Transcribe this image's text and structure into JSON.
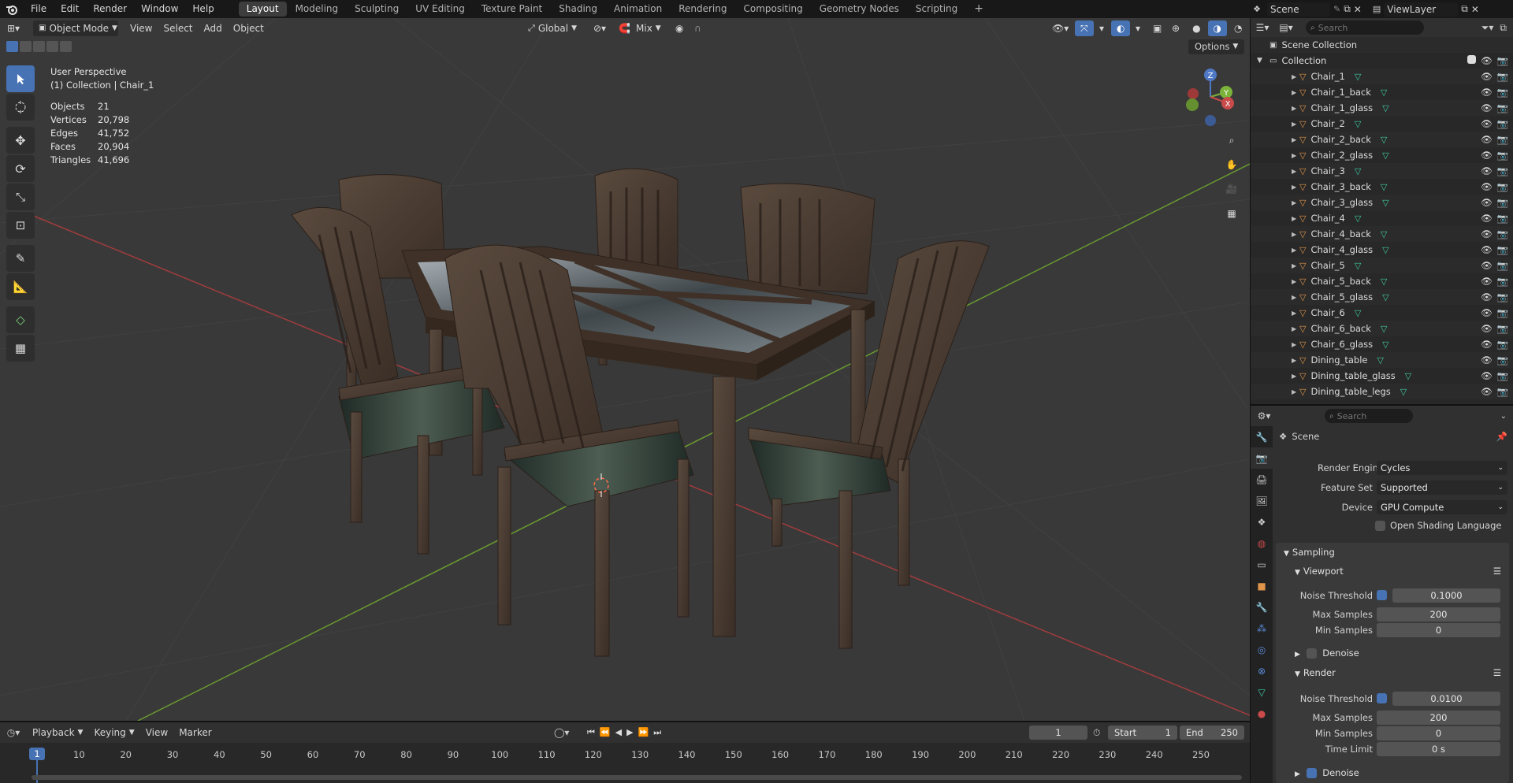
{
  "menu": {
    "items": [
      "File",
      "Edit",
      "Render",
      "Window",
      "Help"
    ]
  },
  "workspaces": {
    "tabs": [
      "Layout",
      "Modeling",
      "Sculpting",
      "UV Editing",
      "Texture Paint",
      "Shading",
      "Animation",
      "Rendering",
      "Compositing",
      "Geometry Nodes",
      "Scripting"
    ],
    "active": "Layout",
    "add": "+"
  },
  "scene": {
    "label": "Scene"
  },
  "viewlayer": {
    "label": "ViewLayer"
  },
  "viewport": {
    "mode": "Object Mode",
    "menus": [
      "View",
      "Select",
      "Add",
      "Object"
    ],
    "orientation": "Global",
    "snap_mode": "Mix",
    "options": "Options",
    "overlay_title": "User Perspective",
    "overlay_subtitle": "(1) Collection | Chair_1",
    "stats": [
      {
        "label": "Objects",
        "value": "21"
      },
      {
        "label": "Vertices",
        "value": "20,798"
      },
      {
        "label": "Edges",
        "value": "41,752"
      },
      {
        "label": "Faces",
        "value": "20,904"
      },
      {
        "label": "Triangles",
        "value": "41,696"
      }
    ],
    "gizmo": {
      "z": "Z",
      "y": "Y",
      "x": "X"
    }
  },
  "outliner": {
    "search_placeholder": "Search",
    "root": "Scene Collection",
    "collection": "Collection",
    "items": [
      "Chair_1",
      "Chair_1_back",
      "Chair_1_glass",
      "Chair_2",
      "Chair_2_back",
      "Chair_2_glass",
      "Chair_3",
      "Chair_3_back",
      "Chair_3_glass",
      "Chair_4",
      "Chair_4_back",
      "Chair_4_glass",
      "Chair_5",
      "Chair_5_back",
      "Chair_5_glass",
      "Chair_6",
      "Chair_6_back",
      "Chair_6_glass",
      "Dining_table",
      "Dining_table_glass",
      "Dining_table_legs"
    ]
  },
  "properties": {
    "search_placeholder": "Search",
    "context": "Scene",
    "render_engine_label": "Render Engine",
    "render_engine": "Cycles",
    "feature_set_label": "Feature Set",
    "feature_set": "Supported",
    "device_label": "Device",
    "device": "GPU Compute",
    "osl_label": "Open Shading Language",
    "sampling": "Sampling",
    "viewport": "Viewport",
    "vp_noise_label": "Noise Threshold",
    "vp_noise": "0.1000",
    "vp_max_label": "Max Samples",
    "vp_max": "200",
    "vp_min_label": "Min Samples",
    "vp_min": "0",
    "denoise": "Denoise",
    "render": "Render",
    "r_noise_label": "Noise Threshold",
    "r_noise": "0.0100",
    "r_max_label": "Max Samples",
    "r_max": "200",
    "r_min_label": "Min Samples",
    "r_min": "0",
    "time_limit_label": "Time Limit",
    "time_limit": "0 s",
    "denoise2": "Denoise"
  },
  "timeline": {
    "menus": [
      "Playback",
      "Keying",
      "View",
      "Marker"
    ],
    "current_frame": "1",
    "start_label": "Start",
    "start": "1",
    "end_label": "End",
    "end": "250",
    "playhead": "1",
    "ticks": [
      "10",
      "20",
      "30",
      "40",
      "50",
      "60",
      "70",
      "80",
      "90",
      "100",
      "110",
      "120",
      "130",
      "140",
      "150",
      "160",
      "170",
      "180",
      "190",
      "200",
      "210",
      "220",
      "230",
      "240",
      "250"
    ]
  },
  "colors": {
    "accent": "#4772b3",
    "mesh_icon": "#e0954a",
    "data_icon": "#3fc9a0",
    "axis_x": "#c94a4a",
    "axis_y": "#7ab23a"
  }
}
